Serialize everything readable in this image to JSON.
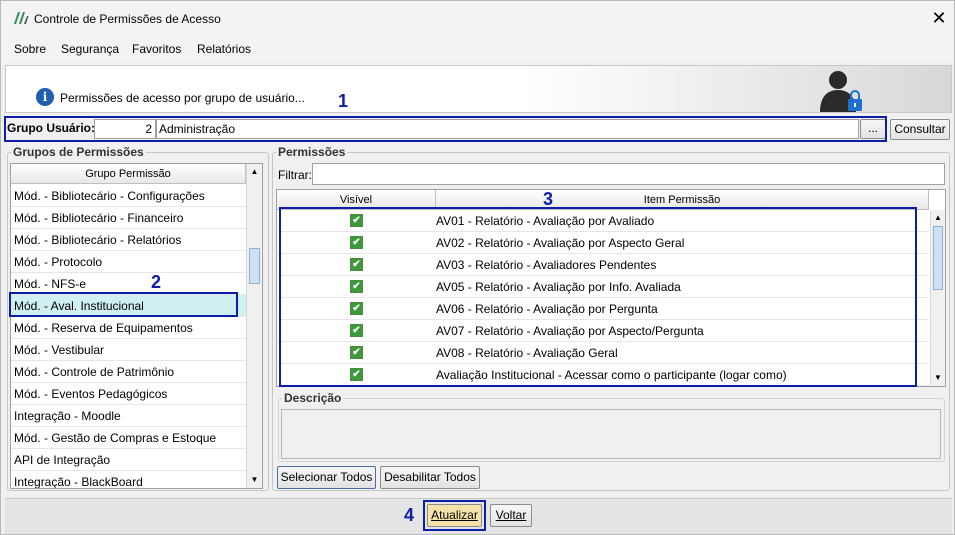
{
  "window": {
    "title": "Controle de Permissões de Acesso",
    "close_label": "✕"
  },
  "menu": [
    {
      "label": "Sobre"
    },
    {
      "label": "Segurança"
    },
    {
      "label": "Favoritos"
    },
    {
      "label": "Relatórios"
    }
  ],
  "header": {
    "info_icon": "i",
    "text": "Permissões de acesso por grupo de usuário..."
  },
  "annotations": [
    "1",
    "2",
    "3",
    "4"
  ],
  "grupo_usuario": {
    "label": "Grupo Usuário:",
    "code": "2",
    "name": "Administração",
    "ellipsis_label": "...",
    "consultar_label": "Consultar"
  },
  "grupos_permissoes": {
    "title": "Grupos de Permissões",
    "column_header": "Grupo Permissão",
    "items": [
      "Mód. - Bibliotecário - Configurações",
      "Mód. - Bibliotecário - Financeiro",
      "Mód. - Bibliotecário - Relatórios",
      "Mód. - Protocolo",
      "Mód. - NFS-e",
      "Mód. - Aval. Institucional",
      "Mód. - Reserva de Equipamentos",
      "Mód. - Vestibular",
      "Mód. - Controle de Patrimônio",
      "Mód. - Eventos Pedagógicos",
      "Integração - Moodle",
      "Mód. - Gestão de Compras e Estoque",
      "API de Integração",
      "Integração - BlackBoard"
    ],
    "selected_index": 5
  },
  "permissoes": {
    "title": "Permissões",
    "filter_label": "Filtrar:",
    "filter_value": "",
    "columns": [
      "Visível",
      "Item Permissão"
    ],
    "rows": [
      {
        "visible": true,
        "item": "AV01 - Relatório - Avaliação por Avaliado"
      },
      {
        "visible": true,
        "item": "AV02 - Relatório - Avaliação por Aspecto Geral"
      },
      {
        "visible": true,
        "item": "AV03 - Relatório - Avaliadores Pendentes"
      },
      {
        "visible": true,
        "item": "AV05 - Relatório - Avaliação por Info. Avaliada"
      },
      {
        "visible": true,
        "item": "AV06 - Relatório - Avaliação por Pergunta"
      },
      {
        "visible": true,
        "item": "AV07 - Relatório - Avaliação por Aspecto/Pergunta"
      },
      {
        "visible": true,
        "item": "AV08 - Relatório - Avaliação Geral"
      },
      {
        "visible": true,
        "item": "Avaliação Institucional - Acessar como o participante (logar como)"
      }
    ],
    "check_glyph": "✔"
  },
  "descricao": {
    "title": "Descrição",
    "text": ""
  },
  "buttons": {
    "selecionar_todos": "Selecionar Todos",
    "desabilitar_todos": "Desabilitar Todos",
    "atualizar": "Atualizar",
    "voltar": "Voltar"
  },
  "colors": {
    "annotation_blue": "#0a1ea8",
    "selected_row": "#cfeff0",
    "checkbox_green": "#3c9a3c",
    "atualizar_bg": "#f3e3a8"
  }
}
